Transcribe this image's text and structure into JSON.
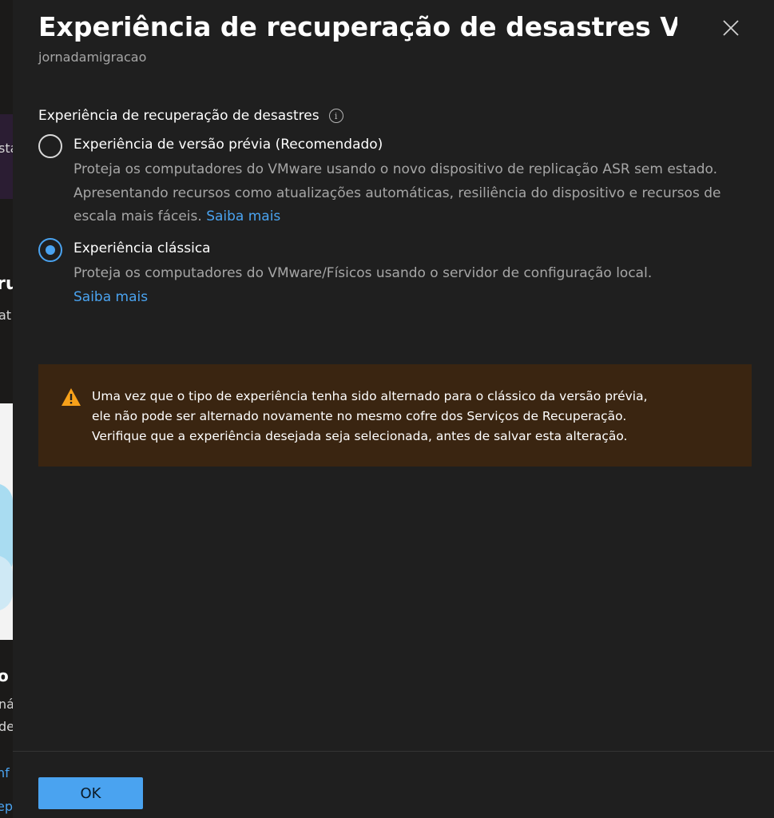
{
  "background": {
    "fragments": [
      "sta",
      "ru",
      "at",
      "o",
      "ná",
      "de",
      "nf",
      "ep"
    ]
  },
  "panel": {
    "title": "Experiência de recuperação de desastres V...",
    "subtitle": "jornadamigracao",
    "section_label": "Experiência de recuperação de desastres",
    "options": [
      {
        "label": "Experiência de versão prévia (Recomendado)",
        "description": "Proteja os computadores do VMware usando o novo dispositivo de replicação ASR sem estado. Apresentando recursos como atualizações automáticas, resiliência do dispositivo e recursos de escala mais fáceis.",
        "link": "Saiba mais",
        "selected": false
      },
      {
        "label": "Experiência clássica",
        "description": "Proteja os computadores do VMware/Físicos usando o servidor de configuração local.",
        "link": "Saiba mais",
        "selected": true
      }
    ],
    "warning": {
      "lines": [
        "Uma vez que o tipo de experiência tenha sido alternado para o clássico da versão prévia,",
        "ele não pode ser alternado novamente no mesmo cofre dos Serviços de Recuperação.",
        "Verifique que a experiência desejada seja selecionada, antes de salvar esta alteração."
      ]
    },
    "ok_label": "OK"
  },
  "icons": {
    "close": "close-icon",
    "info": "info-icon",
    "warning": "warning-icon"
  },
  "colors": {
    "accent": "#4aa3f0",
    "warning_bg": "#3a2511",
    "warning_icon": "#f7a11a",
    "panel_bg": "#1f1f1f"
  }
}
